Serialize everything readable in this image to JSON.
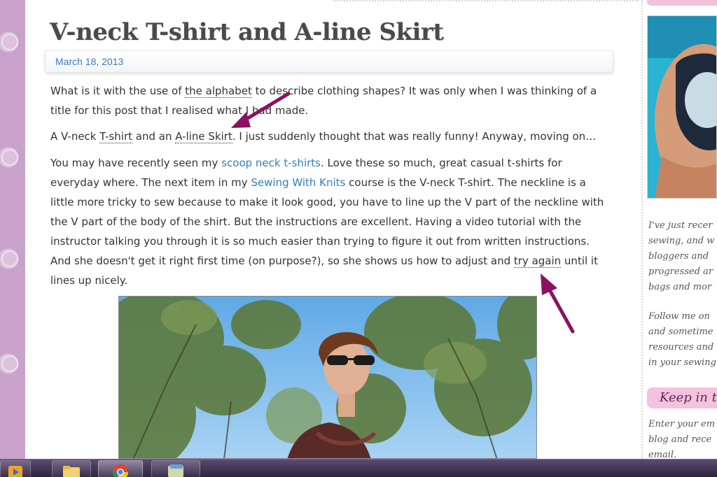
{
  "post": {
    "title": "V-neck T-shirt and A-line Skirt",
    "date": "March 18, 2013",
    "p1": {
      "t1": "What is it with the use of ",
      "link_alphabet": "the alphabet",
      "t2": " to describe clothing shapes?  It was only when I was thinking of a title for this post that I realised what I had made."
    },
    "p2": {
      "t1": "A V-neck ",
      "link_tshirt": "T-shirt",
      "t2": " and an ",
      "link_aline": "A-line Skirt",
      "t3": ".  I just suddenly thought that was really funny!  Anyway, moving on…"
    },
    "p3": {
      "t1": "You may have recently seen my ",
      "link_scoop": "scoop neck t-shirts",
      "t2": ".  Love these so much, great casual t-shirts for everyday where.  The next item in my ",
      "link_course": "Sewing With Knits",
      "t3": " course is the V-neck T-shirt.  The neckline is a little more tricky to sew because to make it look good, you have to line up the V part of the neckline with the V part of the body of the shirt.  But the instructions are excellent.  Having a video tutorial with the instructor talking you through it is so much easier than trying to figure it out from written instructions.  And she doesn't get it right first time (on purpose?), so she shows us how to adjust and ",
      "link_tryagain": "try again",
      "t4": " until it lines up nicely."
    }
  },
  "sidebar": {
    "text1": [
      "I've just recer",
      "sewing, and w",
      "bloggers and",
      "progressed ar",
      "bags and mor"
    ],
    "text2": [
      "Follow me on",
      "and sometime",
      "resources and",
      "in your sewing"
    ],
    "heading": "Keep in t",
    "text3": [
      "Enter your em",
      "blog and rece",
      "email."
    ]
  },
  "annotations": {
    "arrow_color": "#8b1260"
  },
  "taskbar": {
    "apps": [
      "media-player-icon",
      "folder-icon",
      "chrome-icon",
      "window-icon"
    ]
  }
}
